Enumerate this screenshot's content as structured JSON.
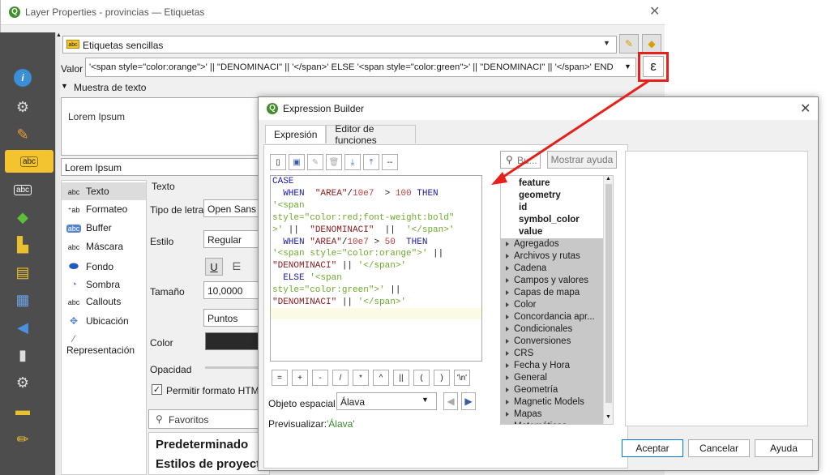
{
  "layer_props": {
    "title": "Layer Properties - provincias — Etiquetas",
    "mode_select": "Etiquetas sencillas",
    "valor_label": "Valor",
    "valor_text": "'<span style=\"color:orange\">' || \"DENOMINACI\" || '</span>'   ELSE '<span style=\"color:green\">' || \"DENOMINACI\" || '</span>'  END",
    "muestra_header": "Muestra de texto",
    "preview_text": "Lorem Ipsum",
    "sample_input": "Lorem Ipsum",
    "tabs": [
      "Texto",
      "Formateo",
      "Buffer",
      "Máscara",
      "Fondo",
      "Sombra",
      "Callouts",
      "Ubicación",
      "Representación"
    ],
    "section_texto": "Texto",
    "font_label": "Tipo de letra",
    "font_value": "Open Sans",
    "style_label": "Estilo",
    "style_value": "Regular",
    "size_label": "Tamaño",
    "size_value": "10,0000",
    "units_value": "Puntos",
    "color_label": "Color",
    "opacity_label": "Opacidad",
    "html_checkbox": "Permitir formato HTML",
    "favorites_placeholder": "Favoritos",
    "styles_list": [
      "Predeterminado",
      "Estilos de proyecto"
    ]
  },
  "expression_builder": {
    "title": "Expression Builder",
    "tabs": [
      "Expresión",
      "Editor de funciones"
    ],
    "code_lines": [
      [
        {
          "t": "CASE",
          "c": "kw"
        }
      ],
      [
        {
          "t": "  WHEN  ",
          "c": "kw"
        },
        {
          "t": "\"AREA\"",
          "c": "fld"
        },
        {
          "t": "/",
          "c": ""
        },
        {
          "t": "10e7",
          "c": "num"
        },
        {
          "t": "  > ",
          "c": ""
        },
        {
          "t": "100",
          "c": "num"
        },
        {
          "t": " THEN",
          "c": "kw"
        }
      ],
      [
        {
          "t": "'<span",
          "c": "str"
        }
      ],
      [
        {
          "t": "style=\"color:red;font-weight:bold\"",
          "c": "str"
        }
      ],
      [
        {
          "t": ">'",
          "c": "str"
        },
        {
          "t": " ||  ",
          "c": ""
        },
        {
          "t": "\"DENOMINACI\"",
          "c": "fld"
        },
        {
          "t": "  ||  ",
          "c": ""
        },
        {
          "t": "'</span>'",
          "c": "str"
        }
      ],
      [
        {
          "t": "  WHEN ",
          "c": "kw"
        },
        {
          "t": "\"AREA\"",
          "c": "fld"
        },
        {
          "t": "/",
          "c": ""
        },
        {
          "t": "10e7",
          "c": "num"
        },
        {
          "t": " > ",
          "c": ""
        },
        {
          "t": "50",
          "c": "num"
        },
        {
          "t": "  THEN",
          "c": "kw"
        }
      ],
      [
        {
          "t": "'<span style=\"color:orange\">'",
          "c": "str"
        },
        {
          "t": " ||",
          "c": ""
        }
      ],
      [
        {
          "t": "\"DENOMINACI\"",
          "c": "fld"
        },
        {
          "t": " || ",
          "c": ""
        },
        {
          "t": "'</span>'",
          "c": "str"
        }
      ],
      [
        {
          "t": "  ELSE ",
          "c": "kw"
        },
        {
          "t": "'<span",
          "c": "str"
        }
      ],
      [
        {
          "t": "style=\"color:green\">'",
          "c": "str"
        },
        {
          "t": " ||",
          "c": ""
        }
      ],
      [
        {
          "t": "\"DENOMINACI\"",
          "c": "fld"
        },
        {
          "t": " || ",
          "c": ""
        },
        {
          "t": "'</span>'",
          "c": "str"
        }
      ],
      [
        {
          "t": "END",
          "c": "kw"
        }
      ]
    ],
    "operators": [
      "=",
      "+",
      "-",
      "/",
      "*",
      "^",
      "||",
      "(",
      ")",
      "'\\n'"
    ],
    "objeto_label": "Objeto espacial",
    "objeto_value": "Álava",
    "preview_label": "Previsualizar:",
    "preview_value": "'Álava'",
    "search_placeholder": "Bu...",
    "help_button": "Mostrar ayuda",
    "functions_bold": [
      "feature",
      "geometry",
      "id",
      "symbol_color",
      "value"
    ],
    "function_groups": [
      "Agregados",
      "Archivos y rutas",
      "Cadena",
      "Campos y valores",
      "Capas de mapa",
      "Color",
      "Concordancia apr...",
      "Condicionales",
      "Conversiones",
      "CRS",
      "Fecha y Hora",
      "General",
      "Geometría",
      "Magnetic Models",
      "Mapas",
      "Matemáticas"
    ],
    "buttons": {
      "accept": "Aceptar",
      "cancel": "Cancelar",
      "help": "Ayuda"
    }
  },
  "colors": {
    "highlight": "#e8201a",
    "qgis_green": "#3f8f2a"
  }
}
